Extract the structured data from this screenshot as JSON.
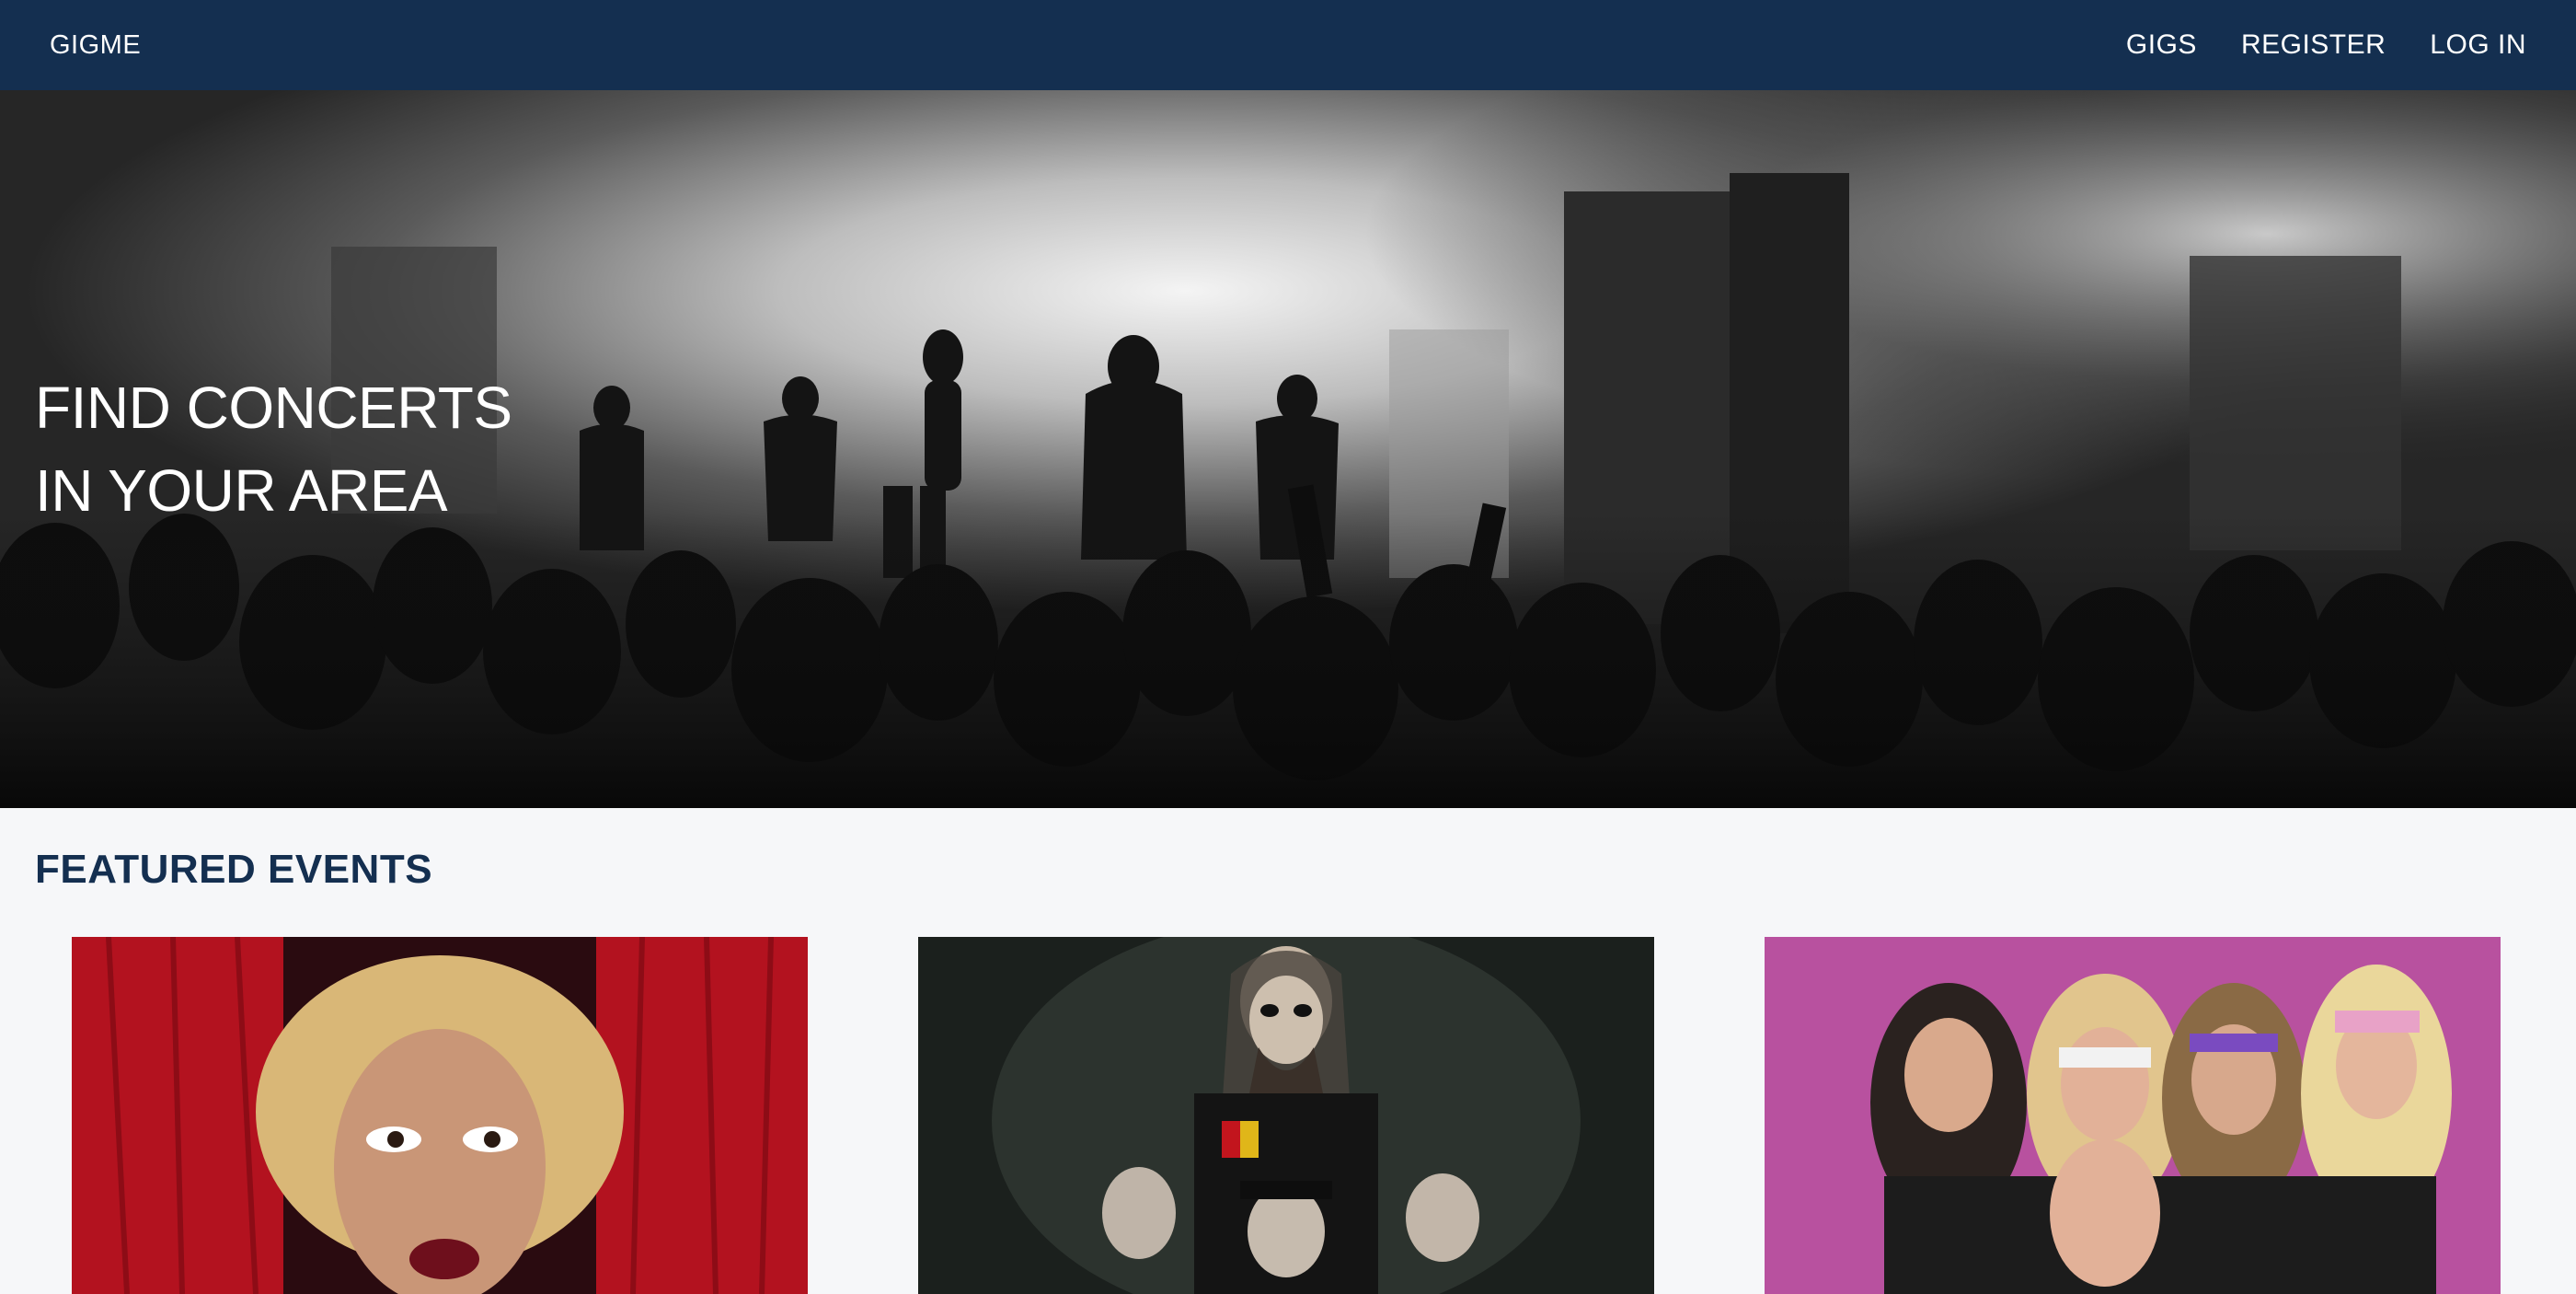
{
  "nav": {
    "brand": "GIGME",
    "links": [
      {
        "label": "GIGS"
      },
      {
        "label": "REGISTER"
      },
      {
        "label": "LOG IN"
      }
    ]
  },
  "hero": {
    "title_line1": "FIND CONCERTS",
    "title_line2": "IN YOUR AREA",
    "image": "black-and-white-concert-crowd-photo"
  },
  "featured": {
    "heading": "FEATURED EVENTS",
    "events": [
      {
        "image": "drag-performer-red-curtain-photo",
        "accent": "#c1121f"
      },
      {
        "image": "dark-metal-band-photo",
        "accent": "#1e2320"
      },
      {
        "image": "glam-rock-band-pink-background-photo",
        "accent": "#b8519f"
      }
    ]
  },
  "colors": {
    "navbar": "#142f50",
    "heading": "#142f50",
    "page_background": "#f6f7f9"
  }
}
